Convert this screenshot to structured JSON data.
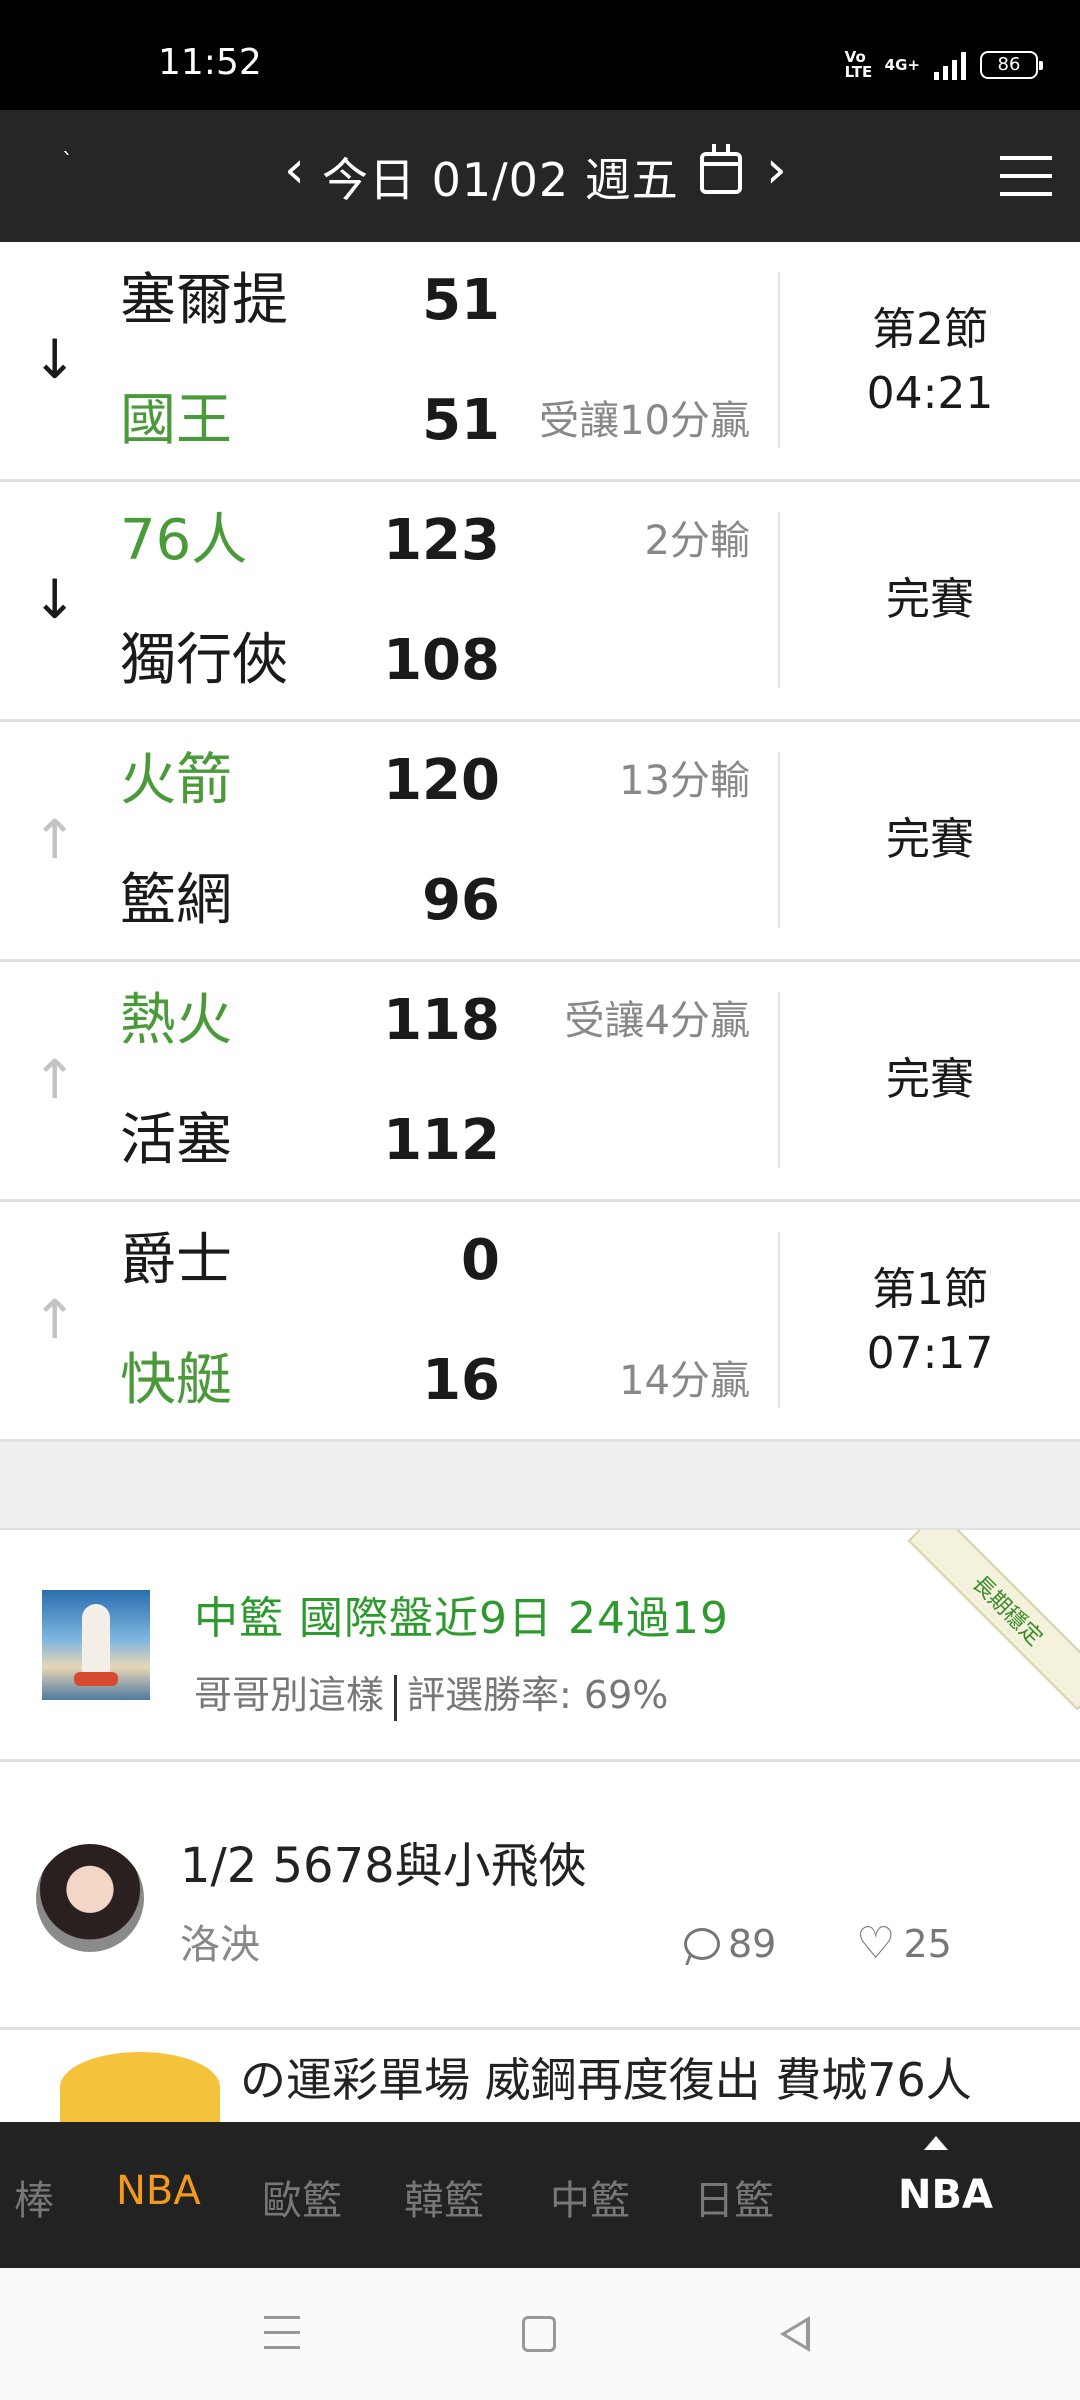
{
  "status_bar": {
    "time": "11:52",
    "volte": "Vo LTE",
    "network": "4G+",
    "battery": "86"
  },
  "header": {
    "prev_icon": "chevron-left-icon",
    "date_label": "今日 01/02 週五",
    "calendar_icon": "calendar-icon",
    "next_icon": "chevron-right-icon",
    "menu_icon": "hamburger-menu-icon"
  },
  "games": [
    {
      "arrow": "↓",
      "team1": "塞爾提",
      "score1": "51",
      "note1": "",
      "team2": "國王",
      "score2": "51",
      "note2": "受讓10分贏",
      "status": "第2節",
      "status_time": "04:21"
    },
    {
      "arrow": "↓",
      "team1": "76人",
      "score1": "123",
      "note1": "2分輸",
      "team2": "獨行俠",
      "score2": "108",
      "note2": "",
      "status": "完賽",
      "status_time": ""
    },
    {
      "arrow": "↑",
      "team1": "火箭",
      "score1": "120",
      "note1": "13分輸",
      "team2": "籃網",
      "score2": "96",
      "note2": "",
      "status": "完賽",
      "status_time": ""
    },
    {
      "arrow": "↑",
      "team1": "熱火",
      "score1": "118",
      "note1": "受讓4分贏",
      "team2": "活塞",
      "score2": "112",
      "note2": "",
      "status": "完賽",
      "status_time": ""
    },
    {
      "arrow": "↑",
      "team1": "爵士",
      "score1": "0",
      "note1": "",
      "team2": "快艇",
      "score2": "16",
      "note2": "14分贏",
      "status": "第1節",
      "status_time": "07:17"
    }
  ],
  "articles": {
    "featured": {
      "title": "中籃 國際盤近9日 24過19",
      "author": "哥哥別這樣",
      "win_rate": "評選勝率: 69%",
      "ribbon": "長期穩定"
    },
    "post": {
      "title": "1/2 5678與小飛俠",
      "author": "洛泱",
      "comments": "89",
      "likes": "25"
    },
    "partial": {
      "title": "の運彩單場 威鋼再度復出 費城76人"
    }
  },
  "tabs": {
    "items": [
      "棒",
      "NBA",
      "歐籃",
      "韓籃",
      "中籃",
      "日籃"
    ],
    "current": "NBA"
  },
  "colors": {
    "home_team_green": "#4a9a3a",
    "tab_active": "#f39a1c",
    "header_bg": "#262626"
  }
}
